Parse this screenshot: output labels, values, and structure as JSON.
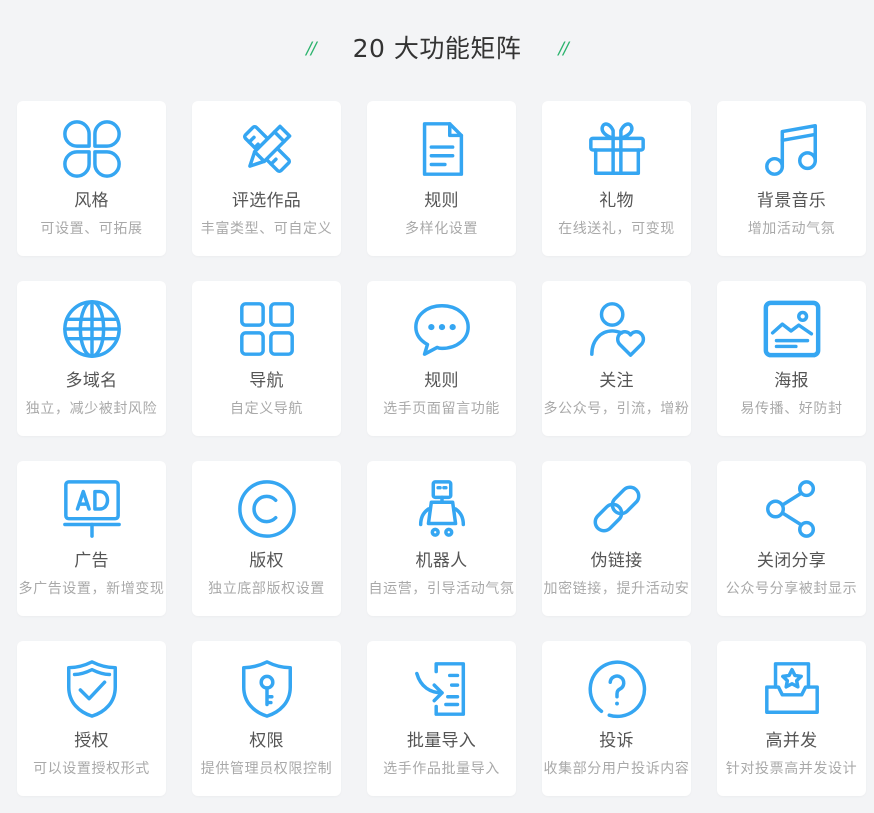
{
  "header": {
    "title": "20 大功能矩阵",
    "deco_left": "//",
    "deco_right": "//"
  },
  "colors": {
    "background": "#f3f4f6",
    "card_background": "#ffffff",
    "accent": "#35a6f2",
    "deco": "#2cb36d",
    "title": "#333333",
    "card_title": "#555555",
    "card_desc": "#a9a9a9"
  },
  "features": [
    {
      "title": "风格",
      "desc": "可设置、可拓展",
      "icon": "clover-icon"
    },
    {
      "title": "评选作品",
      "desc": "丰富类型、可自定义",
      "icon": "pencil-ruler-icon"
    },
    {
      "title": "规则",
      "desc": "多样化设置",
      "icon": "document-icon"
    },
    {
      "title": "礼物",
      "desc": "在线送礼，可变现",
      "icon": "gift-icon"
    },
    {
      "title": "背景音乐",
      "desc": "增加活动气氛",
      "icon": "music-note-icon"
    },
    {
      "title": "多域名",
      "desc": "独立，减少被封风险",
      "icon": "globe-icon"
    },
    {
      "title": "导航",
      "desc": "自定义导航",
      "icon": "grid-icon"
    },
    {
      "title": "规则",
      "desc": "选手页面留言功能",
      "icon": "chat-bubble-icon"
    },
    {
      "title": "关注",
      "desc": "多公众号，引流，增粉",
      "icon": "user-heart-icon"
    },
    {
      "title": "海报",
      "desc": "易传播、好防封",
      "icon": "poster-icon"
    },
    {
      "title": "广告",
      "desc": "多广告设置，新增变现",
      "icon": "ad-board-icon"
    },
    {
      "title": "版权",
      "desc": "独立底部版权设置",
      "icon": "copyright-icon"
    },
    {
      "title": "机器人",
      "desc": "自运营，引导活动气氛",
      "icon": "robot-icon"
    },
    {
      "title": "伪链接",
      "desc": "加密链接，提升活动安",
      "icon": "link-icon"
    },
    {
      "title": "关闭分享",
      "desc": "公众号分享被封显示",
      "icon": "share-icon"
    },
    {
      "title": "授权",
      "desc": "可以设置授权形式",
      "icon": "shield-check-icon"
    },
    {
      "title": "权限",
      "desc": "提供管理员权限控制",
      "icon": "shield-key-icon"
    },
    {
      "title": "批量导入",
      "desc": "选手作品批量导入",
      "icon": "import-icon"
    },
    {
      "title": "投诉",
      "desc": "收集部分用户投诉内容",
      "icon": "question-circle-icon"
    },
    {
      "title": "高并发",
      "desc": "针对投票高并发设计",
      "icon": "inbox-star-icon"
    }
  ]
}
